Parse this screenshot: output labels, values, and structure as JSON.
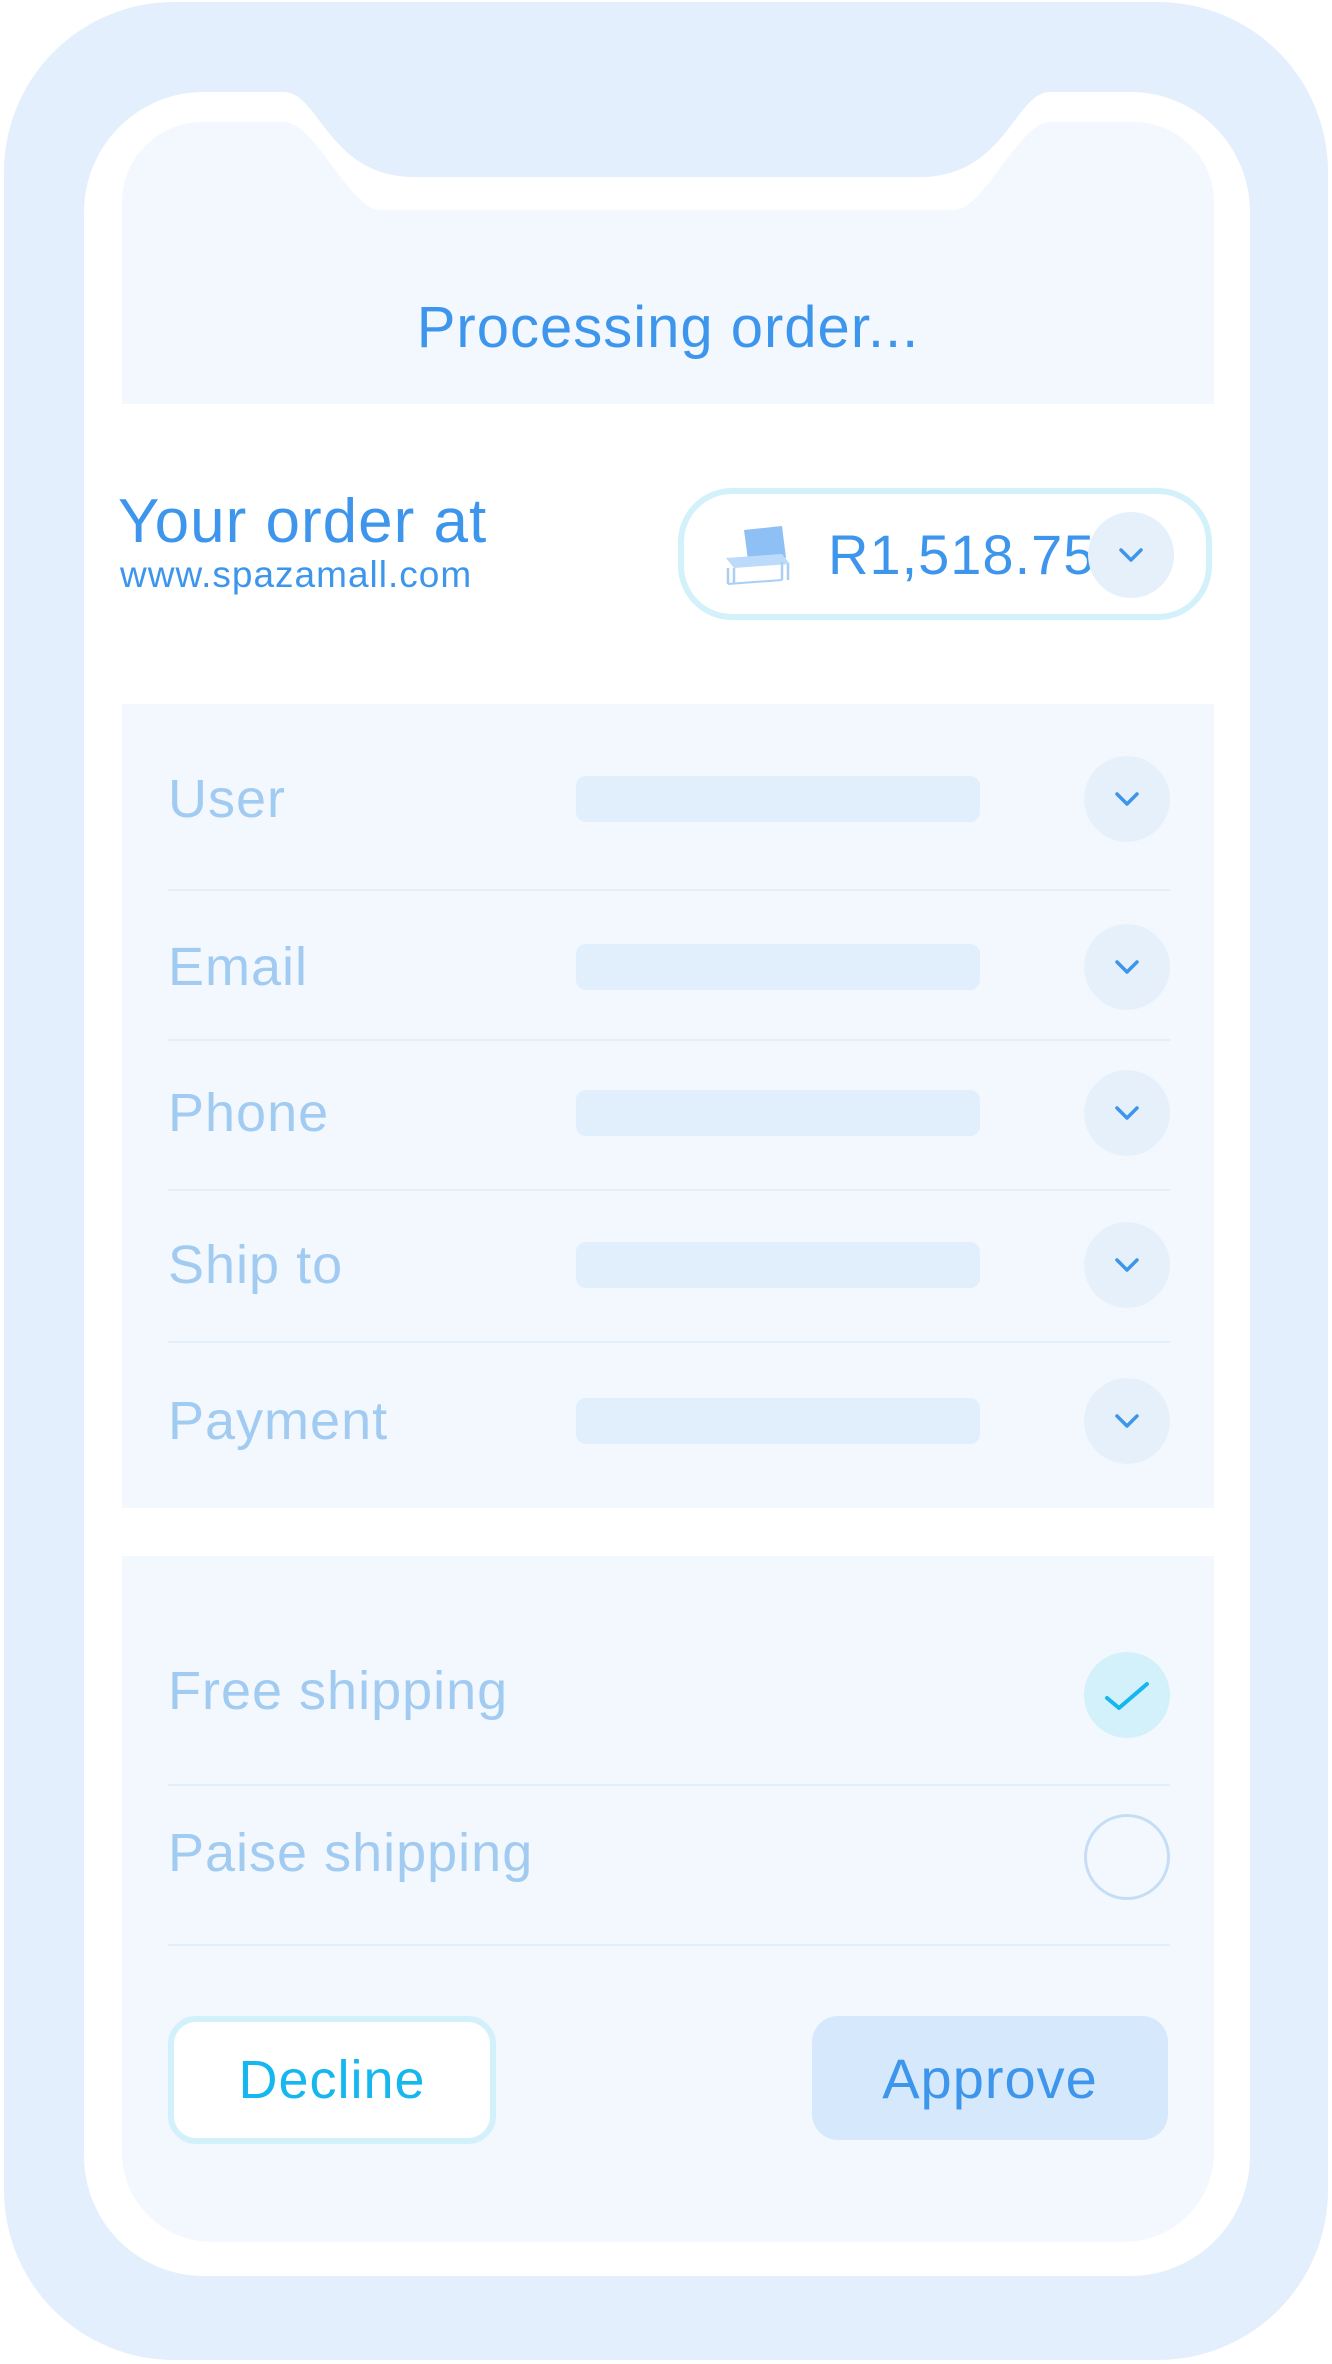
{
  "header": {
    "title": "Processing order..."
  },
  "order": {
    "heading": "Your order at",
    "site": "www.spazamall.com",
    "amount": "R1,518.75",
    "product_icon": "chair-icon"
  },
  "fields": [
    {
      "label": "User"
    },
    {
      "label": "Email"
    },
    {
      "label": "Phone"
    },
    {
      "label": "Ship to"
    },
    {
      "label": "Payment"
    }
  ],
  "shipping_options": [
    {
      "label": "Free shipping",
      "selected": true
    },
    {
      "label": "Paise shipping",
      "selected": false
    }
  ],
  "actions": {
    "decline_label": "Decline",
    "approve_label": "Approve"
  },
  "colors": {
    "accent": "#3d96ec",
    "cyan": "#15b7ee",
    "muted_label": "#a2cbf2",
    "panel": "#f3f8fe",
    "frame": "#e3effc"
  }
}
